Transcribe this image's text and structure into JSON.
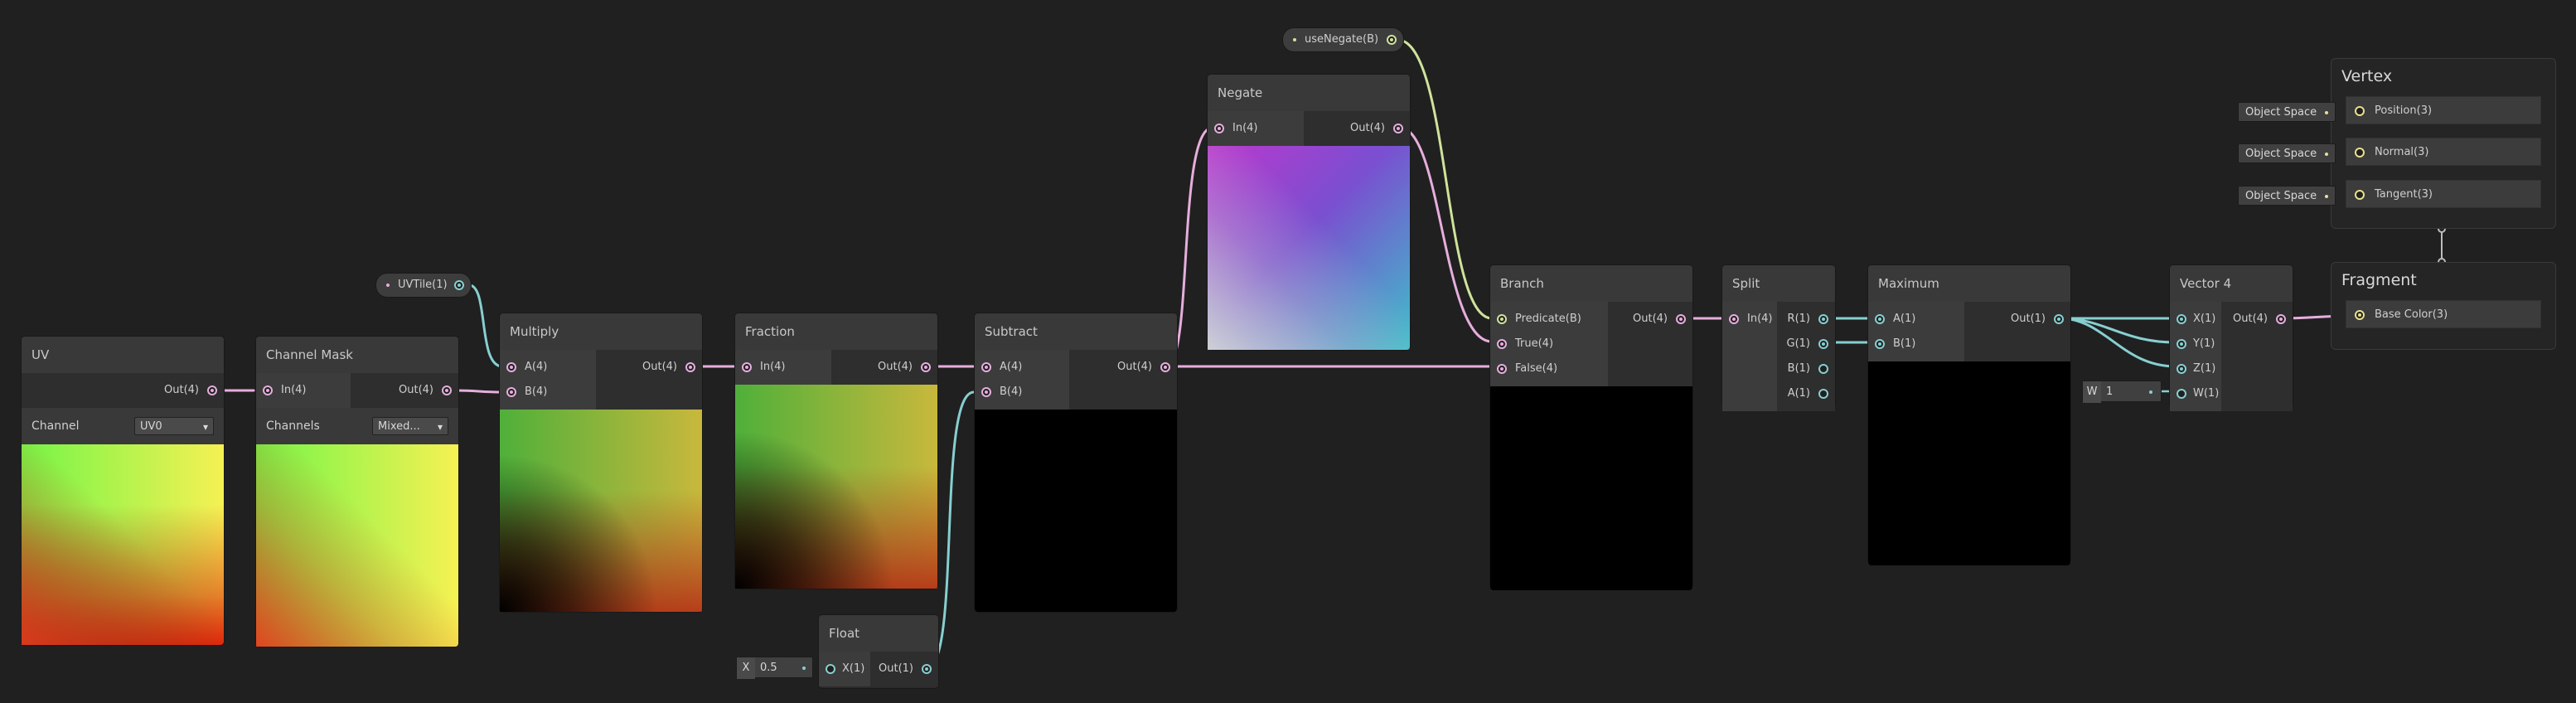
{
  "colors": {
    "canvas": "#202020",
    "vector4_wire": "#e6aedc",
    "vector1_wire": "#87cfd0",
    "bool_wire": "#cfe39a",
    "vector3_wire": "#e9e18e"
  },
  "nodes": {
    "uv": {
      "title": "UV",
      "output": "Out(4)",
      "channel_label": "Channel",
      "channel_value": "UV0"
    },
    "channel_mask": {
      "title": "Channel Mask",
      "input": "In(4)",
      "output": "Out(4)",
      "channels_label": "Channels",
      "channels_value": "Mixed..."
    },
    "multiply": {
      "title": "Multiply",
      "input_a": "A(4)",
      "input_b": "B(4)",
      "output": "Out(4)"
    },
    "fraction": {
      "title": "Fraction",
      "input": "In(4)",
      "output": "Out(4)"
    },
    "subtract": {
      "title": "Subtract",
      "input_a": "A(4)",
      "input_b": "B(4)",
      "output": "Out(4)"
    },
    "float": {
      "title": "Float",
      "input": "X(1)",
      "output": "Out(1)",
      "x_label": "X",
      "x_value": "0.5"
    },
    "negate": {
      "title": "Negate",
      "input": "In(4)",
      "output": "Out(4)"
    },
    "branch": {
      "title": "Branch",
      "predicate": "Predicate(B)",
      "true_input": "True(4)",
      "false_input": "False(4)",
      "output": "Out(4)"
    },
    "split": {
      "title": "Split",
      "input": "In(4)",
      "out_r": "R(1)",
      "out_g": "G(1)",
      "out_b": "B(1)",
      "out_a": "A(1)"
    },
    "maximum": {
      "title": "Maximum",
      "input_a": "A(1)",
      "input_b": "B(1)",
      "output": "Out(1)"
    },
    "vector4": {
      "title": "Vector 4",
      "input_x": "X(1)",
      "input_y": "Y(1)",
      "input_z": "Z(1)",
      "input_w": "W(1)",
      "output": "Out(4)",
      "w_label": "W",
      "w_value": "1"
    }
  },
  "properties": {
    "uvtile": "UVTile(1)",
    "use_negate": "useNegate(B)"
  },
  "master": {
    "vertex": {
      "title": "Vertex",
      "blocks": [
        {
          "label": "Position(3)",
          "space": "Object Space"
        },
        {
          "label": "Normal(3)",
          "space": "Object Space"
        },
        {
          "label": "Tangent(3)",
          "space": "Object Space"
        }
      ]
    },
    "fragment": {
      "title": "Fragment",
      "blocks": [
        {
          "label": "Base Color(3)"
        }
      ]
    }
  }
}
